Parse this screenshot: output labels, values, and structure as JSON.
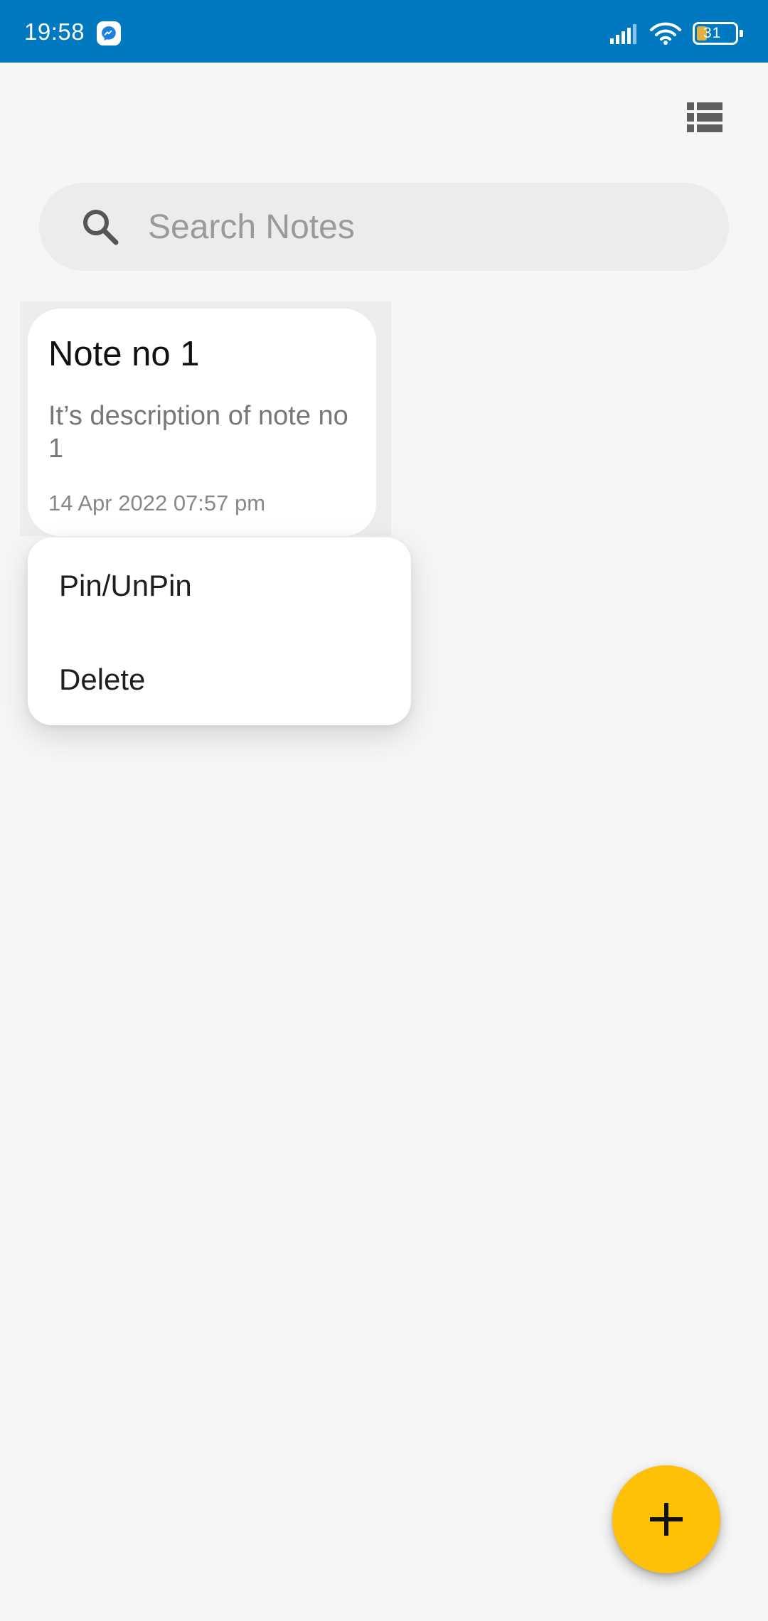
{
  "status_bar": {
    "time": "19:58",
    "battery_level": "31",
    "color": "#0079c1"
  },
  "toolbar": {
    "layout_toggle_icon": "list-view-icon"
  },
  "search": {
    "placeholder": "Search Notes",
    "value": "",
    "icon": "search-icon"
  },
  "notes": [
    {
      "title": "Note no 1",
      "description": "It’s description of note no 1",
      "date": "14 Apr 2022 07:57 pm"
    }
  ],
  "context_menu": {
    "items": [
      {
        "label": "Pin/UnPin"
      },
      {
        "label": "Delete"
      }
    ]
  },
  "fab": {
    "icon": "plus-icon",
    "color": "#ffc107"
  }
}
